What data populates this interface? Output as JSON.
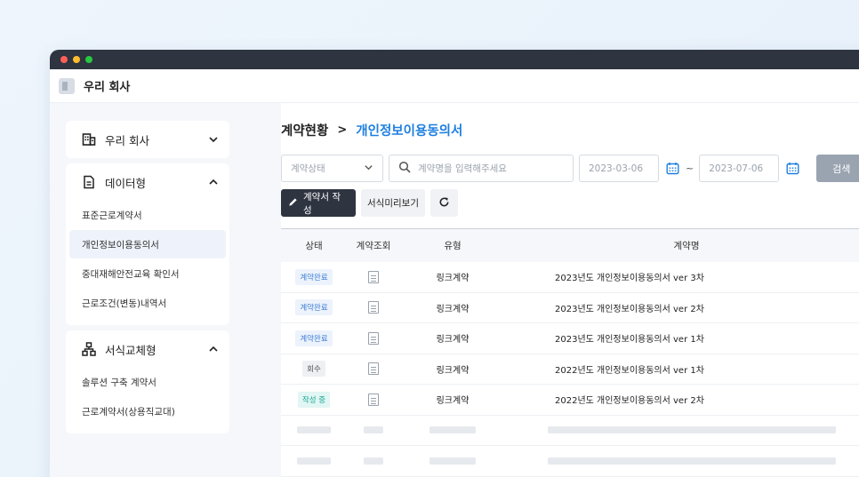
{
  "colors": {
    "accent": "#1e7fe0",
    "titlebar": "#2e3440",
    "traffic_red": "#ff5f57",
    "traffic_yellow": "#febc2e",
    "traffic_green": "#28c840",
    "search_button": "#9aa4b1"
  },
  "app": {
    "title": "우리 회사"
  },
  "sidebar": {
    "company": {
      "label": "우리 회사",
      "icon": "building-icon",
      "expanded": false
    },
    "data_group": {
      "label": "데이터형",
      "icon": "document-icon",
      "expanded": true,
      "items": [
        {
          "label": "표준근로계약서",
          "active": false
        },
        {
          "label": "개인정보이용동의서",
          "active": true
        },
        {
          "label": "중대재해안전교육 확인서",
          "active": false
        },
        {
          "label": "근로조건(변동)내역서",
          "active": false
        }
      ]
    },
    "form_group": {
      "label": "서식교체형",
      "icon": "hierarchy-icon",
      "expanded": true,
      "items": [
        {
          "label": "솔루션 구축 계약서"
        },
        {
          "label": "근로계약서(상용직교대)"
        }
      ]
    }
  },
  "breadcrumb": {
    "root": "계약현황",
    "separator": ">",
    "current": "개인정보이용동의서"
  },
  "filters": {
    "status_placeholder": "계약상태",
    "search_placeholder": "계약명을 입력해주세요",
    "date_from": "2023-03-06",
    "date_to": "2023-07-06",
    "range_separator": "~",
    "search_button": "검색"
  },
  "actions": {
    "write_button": "계약서 작성",
    "preview_button": "서식미리보기"
  },
  "table": {
    "headers": {
      "status": "상태",
      "view": "계약조회",
      "type": "유형",
      "name": "계약명"
    },
    "rows": [
      {
        "status": "계약완료",
        "status_kind": "done",
        "type": "링크계약",
        "name": "2023년도 개인정보이용동의서 ver 3차"
      },
      {
        "status": "계약완료",
        "status_kind": "done",
        "type": "링크계약",
        "name": "2023년도 개인정보이용동의서 ver 2차"
      },
      {
        "status": "계약완료",
        "status_kind": "done",
        "type": "링크계약",
        "name": "2023년도 개인정보이용동의서 ver 1차"
      },
      {
        "status": "회수",
        "status_kind": "recall",
        "type": "링크계약",
        "name": "2022년도 개인정보이용동의서 ver 1차"
      },
      {
        "status": "작성 중",
        "status_kind": "writing",
        "type": "링크계약",
        "name": "2022년도 개인정보이용동의서 ver 2차"
      }
    ],
    "placeholder_rows": 2
  }
}
